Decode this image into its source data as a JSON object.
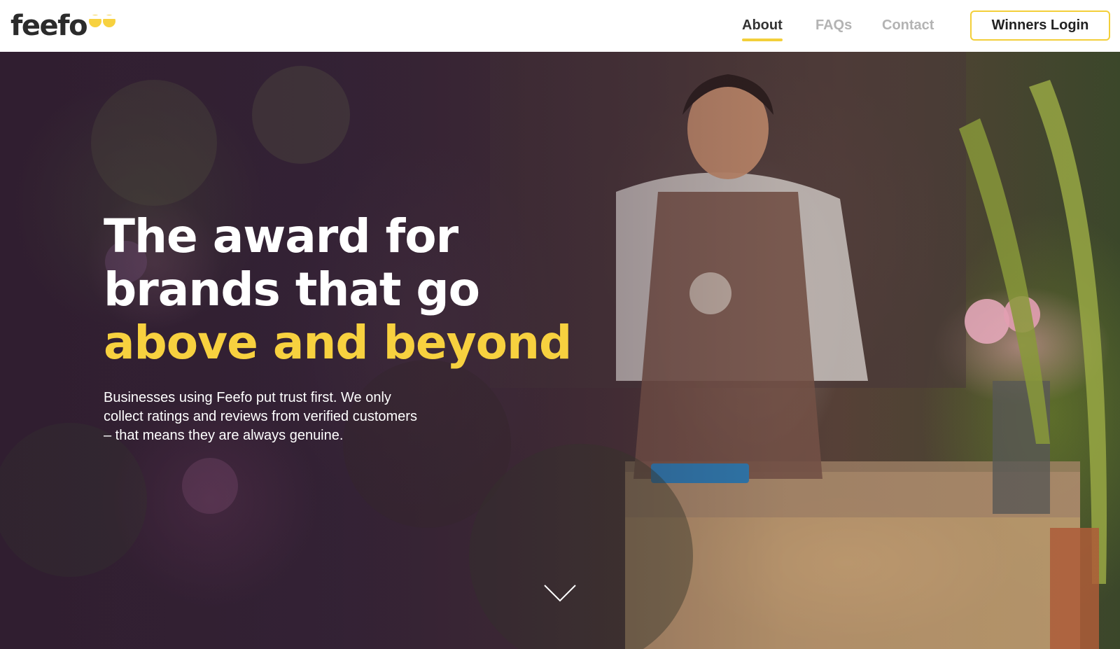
{
  "header": {
    "logo_text": "feefo",
    "nav": [
      {
        "label": "About",
        "active": true
      },
      {
        "label": "FAQs",
        "active": false
      },
      {
        "label": "Contact",
        "active": false
      }
    ],
    "login_label": "Winners Login"
  },
  "hero": {
    "headline_line1": "The award for",
    "headline_line2": "brands that go",
    "headline_line3": "above and beyond",
    "body": "Businesses using Feefo put trust first. We only collect ratings and reviews from verified customers – that means they are always genuine.",
    "scroll_icon": "chevron-down-icon"
  },
  "colors": {
    "accent": "#f7d13f",
    "nav_active": "#333333",
    "nav_inactive": "#b3b3b3"
  }
}
